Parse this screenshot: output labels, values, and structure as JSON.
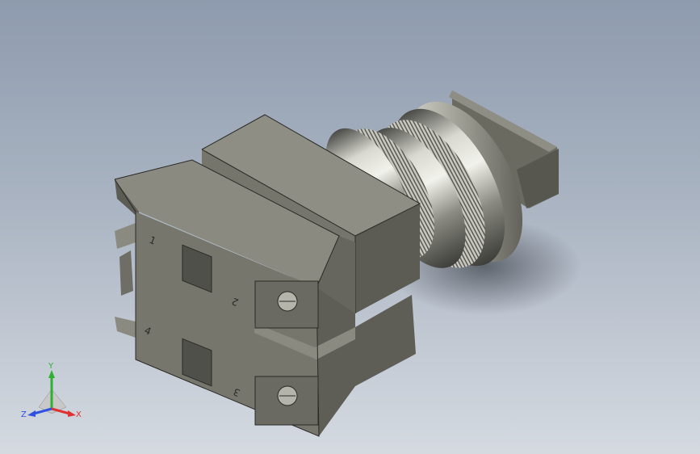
{
  "model": {
    "terminal_numbers": [
      "1",
      "2",
      "3",
      "4"
    ]
  },
  "triad": {
    "x_label": "X",
    "y_label": "Y",
    "z_label": "Z",
    "colors": {
      "x": "#e03030",
      "y": "#30b030",
      "z": "#3050e0"
    }
  }
}
